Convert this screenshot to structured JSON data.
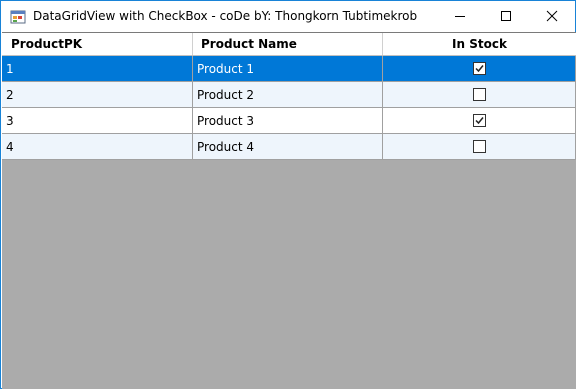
{
  "window": {
    "title": "DataGridView with CheckBox - coDe bY: Thongkorn Tubtimekrob",
    "icon": "windows-form-icon"
  },
  "controls": {
    "minimize_icon": "minimize-icon",
    "maximize_icon": "maximize-icon",
    "close_icon": "close-icon"
  },
  "grid": {
    "columns": [
      "ProductPK",
      "Product Name",
      "In Stock"
    ],
    "rows": [
      {
        "pk": "1",
        "name": "Product 1",
        "in_stock": true,
        "selected": true
      },
      {
        "pk": "2",
        "name": "Product 2",
        "in_stock": false,
        "selected": false
      },
      {
        "pk": "3",
        "name": "Product 3",
        "in_stock": true,
        "selected": false
      },
      {
        "pk": "4",
        "name": "Product 4",
        "in_stock": false,
        "selected": false
      }
    ],
    "colors": {
      "selection": "#0078d7",
      "alt_row": "#eef5fc",
      "empty_area": "#ababab"
    }
  }
}
